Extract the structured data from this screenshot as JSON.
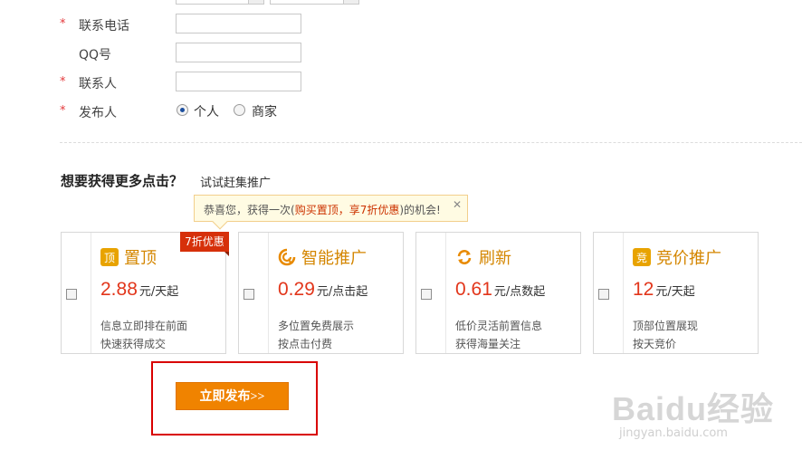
{
  "form": {
    "phone": {
      "required": "*",
      "label": "联系电话",
      "value": ""
    },
    "qq": {
      "required": "",
      "label": "QQ号",
      "value": ""
    },
    "contact": {
      "required": "*",
      "label": "联系人",
      "value": ""
    },
    "publisher": {
      "required": "*",
      "label": "发布人",
      "options": [
        "个人",
        "商家"
      ],
      "selected": "个人"
    }
  },
  "promo": {
    "title": "想要获得更多点击？",
    "subtitle": "试试赶集推广",
    "tip": {
      "prefix": "恭喜您，获得一次(",
      "highlight1": "购买置顶",
      "sep": "，",
      "highlight2": "享7折优惠",
      "suffix": ")的机会!",
      "close": "✕"
    },
    "ribbon": "7折优惠",
    "cards": [
      {
        "icon": "顶",
        "name": "置顶",
        "price": "2.88",
        "unit": "元/天起",
        "desc1": "信息立即排在前面",
        "desc2": "快速获得成交"
      },
      {
        "icon": "smart-promo-icon",
        "name": "智能推广",
        "price": "0.29",
        "unit": "元/点击起",
        "desc1": "多位置免费展示",
        "desc2": "按点击付费"
      },
      {
        "icon": "refresh-icon",
        "name": "刷新",
        "price": "0.61",
        "unit": "元/点数起",
        "desc1": "低价灵活前置信息",
        "desc2": "获得海量关注"
      },
      {
        "icon": "竞",
        "name": "竞价推广",
        "price": "12",
        "unit": "元/天起",
        "desc1": "顶部位置展现",
        "desc2": "按天竞价"
      }
    ]
  },
  "publish_button": "立即发布>>",
  "watermark": {
    "line1": "Baidu经验",
    "line2": "jingyan.baidu.com"
  },
  "colors": {
    "accent": "#f08300",
    "price": "#e2361b",
    "name": "#d48600",
    "highlight": "#d90000"
  }
}
